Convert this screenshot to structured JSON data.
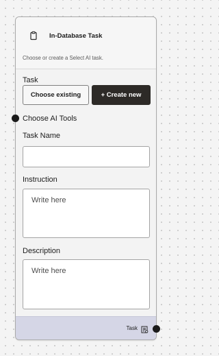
{
  "node": {
    "title": "In-Database Task",
    "icon": "clipboard-icon",
    "description": "Choose or create a Select AI task.",
    "task_section": {
      "label": "Task",
      "choose_existing_label": "Choose existing",
      "create_new_label": "+ Create new"
    },
    "ai_tools_label": "Choose AI Tools",
    "task_name": {
      "label": "Task Name",
      "value": "",
      "placeholder": ""
    },
    "instruction": {
      "label": "Instruction",
      "value": "",
      "placeholder": "Write here"
    },
    "description_field": {
      "label": "Description",
      "value": "",
      "placeholder": "Write here"
    },
    "footer": {
      "label": "Task",
      "icon": "task-list-icon"
    }
  },
  "colors": {
    "primary_button": "#2d2a27",
    "footer_background": "#d5d6e6",
    "port": "#1b1b1b"
  }
}
